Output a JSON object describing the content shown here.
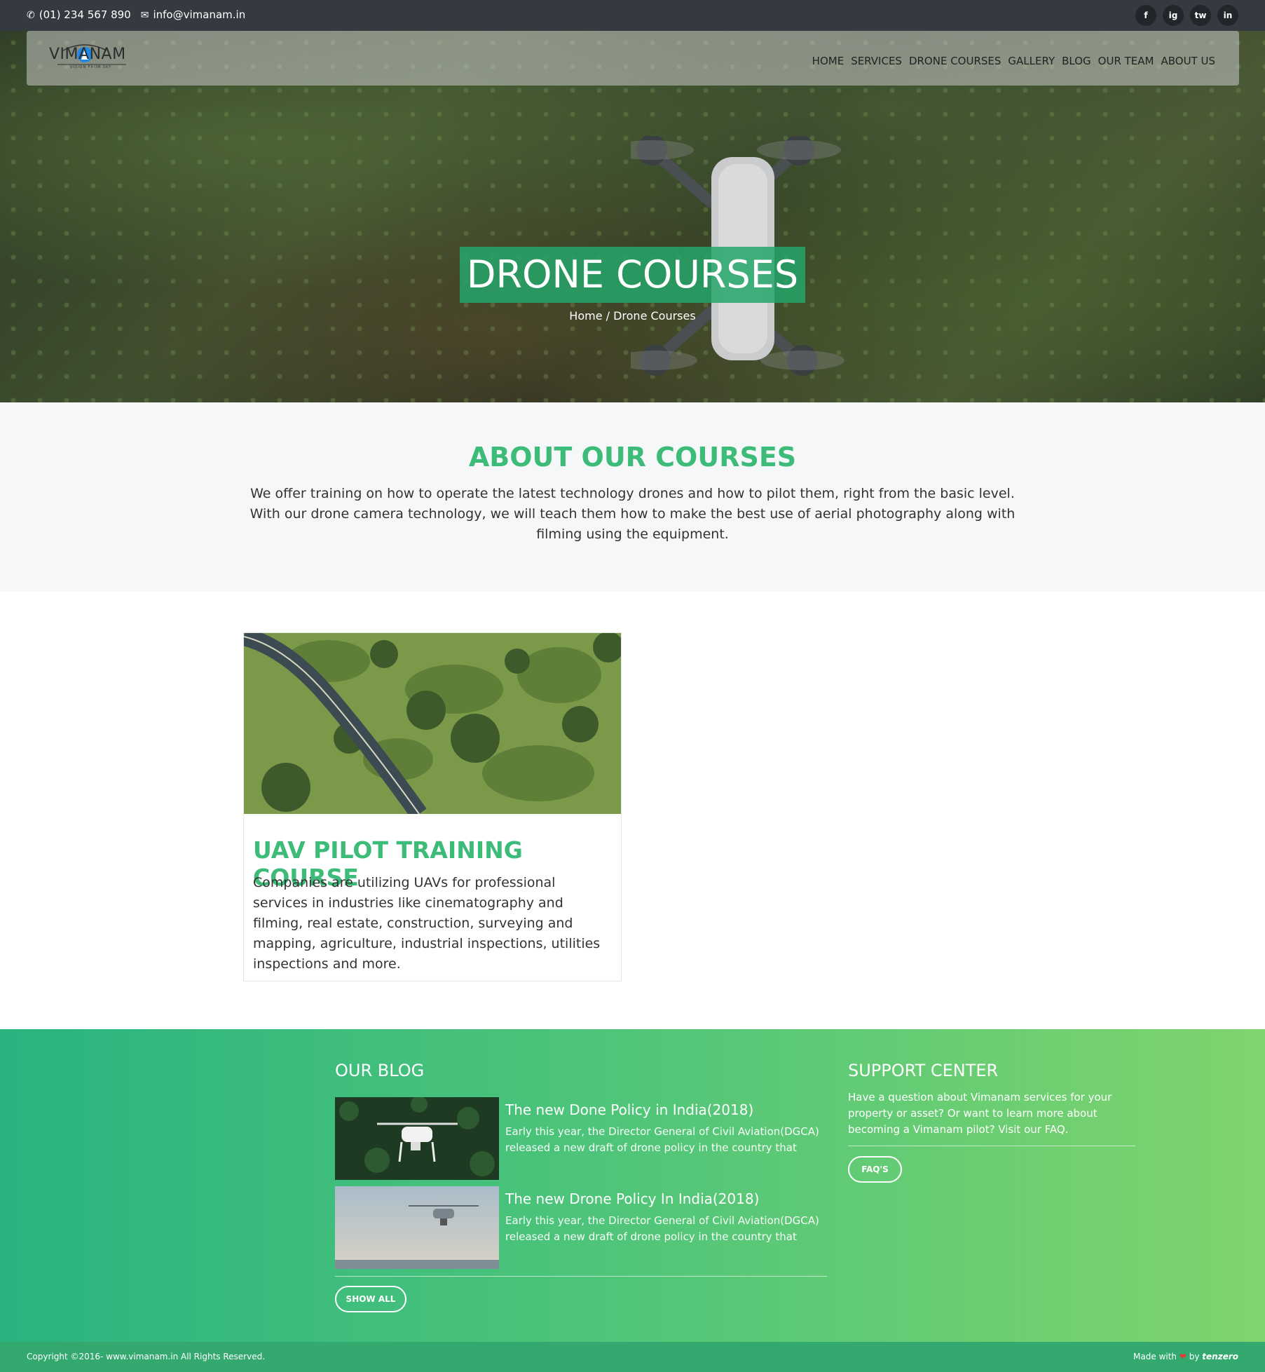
{
  "topbar": {
    "phone": "(01) 234 567 890",
    "email": "info@vimanam.in",
    "social": [
      "f",
      "ig",
      "tw",
      "in"
    ]
  },
  "brand": {
    "name": "VIMANAM",
    "tagline": "VISION FROM SKY"
  },
  "nav": {
    "items": [
      "HOME",
      "SERVICES",
      "DRONE COURSES",
      "GALLERY",
      "BLOG",
      "OUR TEAM",
      "ABOUT US"
    ]
  },
  "hero": {
    "title": "DRONE COURSES",
    "breadcrumb": "Home / Drone Courses"
  },
  "about": {
    "heading": "ABOUT OUR COURSES",
    "text": "We offer training on how to operate the latest technology drones and how to pilot them, right from the basic level. With our drone camera technology, we will teach them how to make the best use of aerial photography along with filming using the equipment."
  },
  "course": {
    "title": "UAV PILOT TRAINING COURSE",
    "text": "Companies are utilizing UAVs for professional services in industries like cinematography and filming, real estate, construction, surveying and mapping, agriculture, industrial inspections, utilities inspections and more."
  },
  "blog": {
    "heading": "OUR BLOG",
    "posts": [
      {
        "title": "The new Done Policy in India(2018)",
        "excerpt": "Early this year, the Director General of Civil Aviation(DGCA) released a new draft of drone policy in the country that"
      },
      {
        "title": "The new Drone Policy In India(2018)",
        "excerpt": "Early this year, the Director General of Civil Aviation(DGCA) released a new draft of drone policy in the country that"
      }
    ],
    "show_all": "SHOW ALL"
  },
  "support": {
    "heading": "SUPPORT CENTER",
    "text": "Have a question about Vimanam services for your property or asset? Or want to learn more about becoming a Vimanam pilot? Visit our FAQ.",
    "button": "FAQ'S"
  },
  "footer": {
    "copyright": "Copyright ©2016- www.vimanam.in All Rights Reserved.",
    "made_with": "Made with",
    "by": "by",
    "maker": "tenzero"
  },
  "colors": {
    "accent": "#3dbb78",
    "topbar": "#343a40"
  }
}
